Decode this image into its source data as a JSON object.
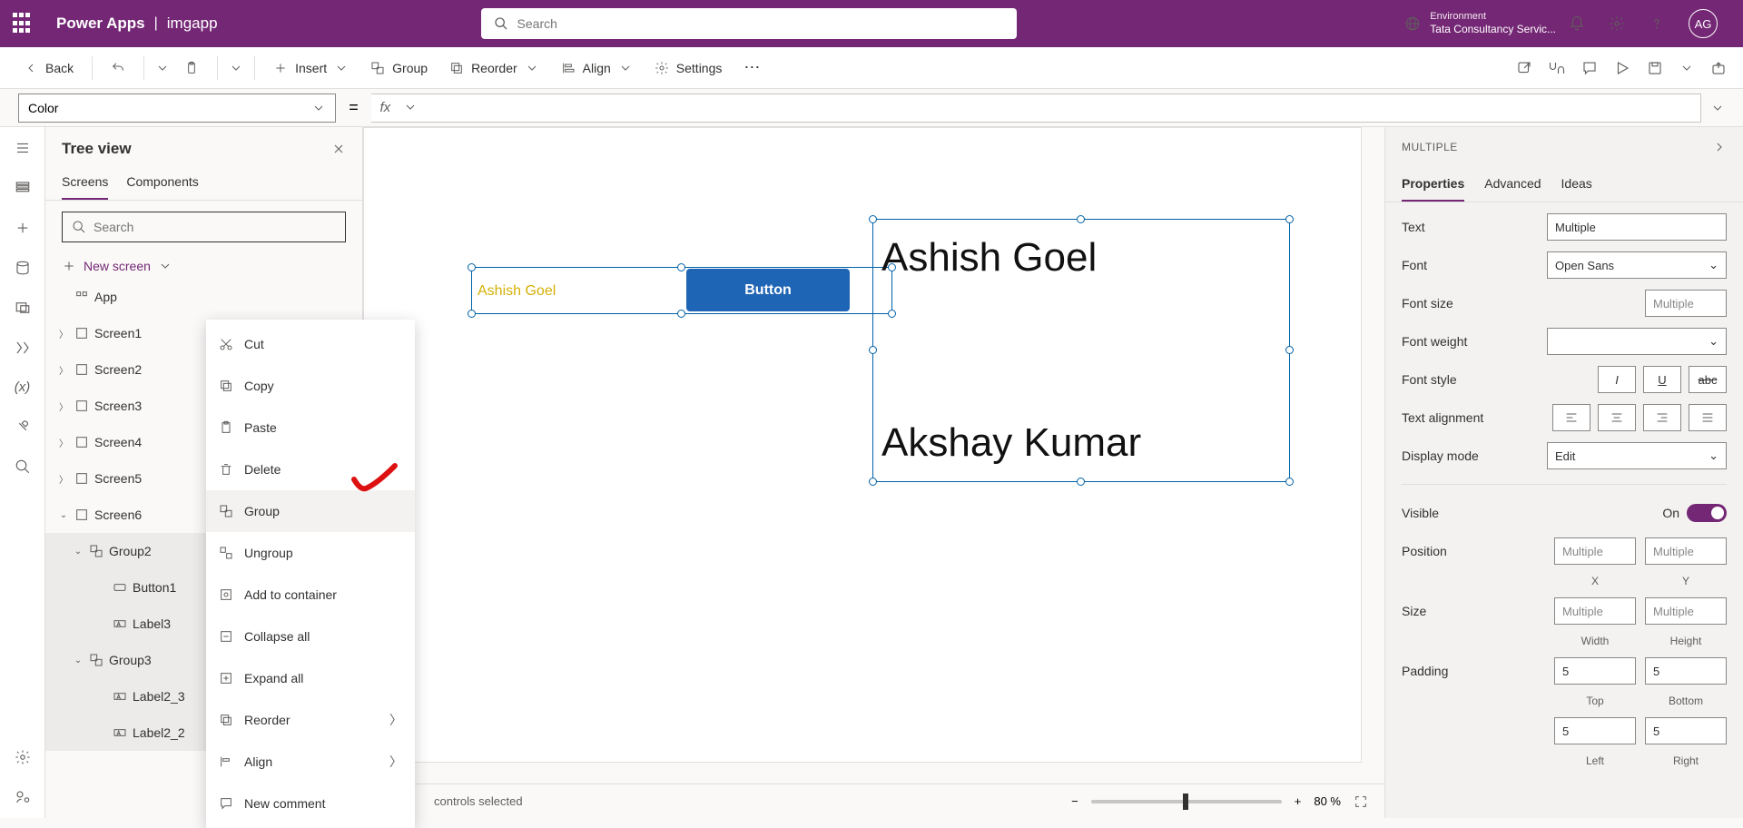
{
  "header": {
    "brand": "Power Apps",
    "app_name": "imgapp",
    "search_placeholder": "Search",
    "env_label": "Environment",
    "env_value": "Tata Consultancy Servic...",
    "avatar_initials": "AG"
  },
  "cmd": {
    "back": "Back",
    "insert": "Insert",
    "group": "Group",
    "reorder": "Reorder",
    "align": "Align",
    "settings": "Settings"
  },
  "formula": {
    "property": "Color",
    "fx": "fx"
  },
  "tree": {
    "title": "Tree view",
    "tabs": {
      "screens": "Screens",
      "components": "Components"
    },
    "search_placeholder": "Search",
    "new_screen": "New screen",
    "items": {
      "app": "App",
      "s1": "Screen1",
      "s2": "Screen2",
      "s3": "Screen3",
      "s4": "Screen4",
      "s5": "Screen5",
      "s6": "Screen6",
      "g2": "Group2",
      "btn1": "Button1",
      "lbl3": "Label3",
      "g3": "Group3",
      "lbl23": "Label2_3",
      "lbl22": "Label2_2"
    }
  },
  "context_menu": {
    "cut": "Cut",
    "copy": "Copy",
    "paste": "Paste",
    "delete": "Delete",
    "group": "Group",
    "ungroup": "Ungroup",
    "add_container": "Add to container",
    "collapse": "Collapse all",
    "expand": "Expand all",
    "reorder": "Reorder",
    "align": "Align",
    "new_comment": "New comment"
  },
  "canvas": {
    "label_text": "Ashish Goel",
    "button_text": "Button",
    "text1": "Ashish Goel",
    "text2": "Akshay Kumar",
    "selection_status": "controls selected",
    "zoom": "80  %"
  },
  "props": {
    "header": "MULTIPLE",
    "tabs": {
      "properties": "Properties",
      "advanced": "Advanced",
      "ideas": "Ideas"
    },
    "text": {
      "label": "Text",
      "value": "Multiple"
    },
    "font": {
      "label": "Font",
      "value": "Open Sans"
    },
    "font_size": {
      "label": "Font size",
      "value": "Multiple"
    },
    "font_weight": {
      "label": "Font weight",
      "value": ""
    },
    "font_style": {
      "label": "Font style"
    },
    "text_align": {
      "label": "Text alignment"
    },
    "display_mode": {
      "label": "Display mode",
      "value": "Edit"
    },
    "visible": {
      "label": "Visible",
      "value": "On"
    },
    "position": {
      "label": "Position",
      "x": "Multiple",
      "y": "Multiple",
      "xl": "X",
      "yl": "Y"
    },
    "size": {
      "label": "Size",
      "w": "Multiple",
      "h": "Multiple",
      "wl": "Width",
      "hl": "Height"
    },
    "padding": {
      "label": "Padding",
      "top": "5",
      "bottom": "5",
      "left": "5",
      "right": "5",
      "tl": "Top",
      "bl": "Bottom",
      "ll": "Left",
      "rl": "Right"
    }
  }
}
